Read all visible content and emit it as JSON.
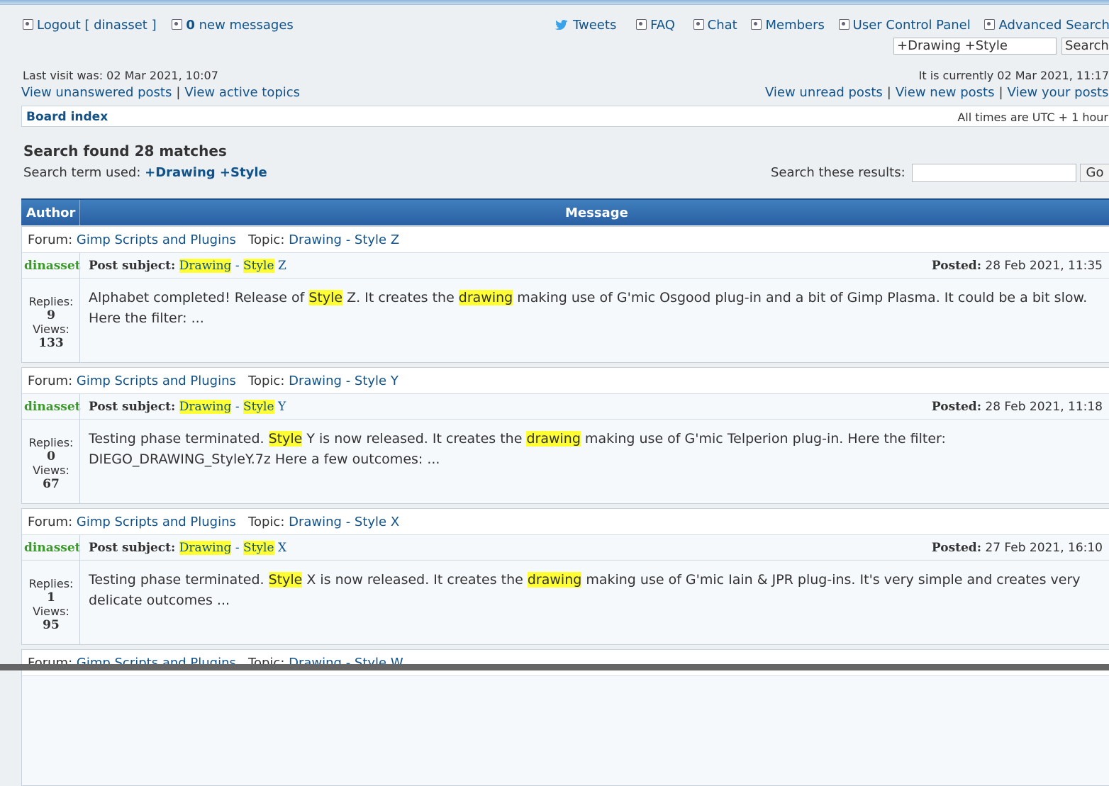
{
  "header": {
    "logout_label": "Logout [ dinasset ]",
    "messages_count": "0",
    "messages_label": "new messages",
    "nav": {
      "tweets": "Tweets",
      "faq": "FAQ",
      "chat": "Chat",
      "members": "Members",
      "ucp": "User Control Panel",
      "advanced_search": "Advanced Search"
    },
    "search_value": "+Drawing  +Style",
    "search_button": "Search",
    "last_visit": "Last visit was: 02 Mar 2021, 10:07",
    "current_time": "It is currently 02 Mar 2021, 11:17",
    "left_links": [
      "View unanswered posts",
      "View active topics"
    ],
    "right_links": [
      "View unread posts",
      "View new posts",
      "View your posts"
    ]
  },
  "breadcrumb": {
    "board_index": "Board index",
    "timezone": "All times are UTC + 1 hour"
  },
  "search": {
    "title": "Search found 28 matches",
    "term_label": "Search term used:",
    "term_value": "+Drawing +Style",
    "these_results_label": "Search these results:",
    "go_button": "Go"
  },
  "table": {
    "author_header": "Author",
    "message_header": "Message"
  },
  "labels": {
    "forum": "Forum:",
    "topic": "Topic:",
    "post_subject": "Post subject:",
    "posted": "Posted:",
    "replies": "Replies:",
    "views": "Views:",
    "sep": "-"
  },
  "results": [
    {
      "forum": "Gimp Scripts and Plugins",
      "topic": "Drawing - Style Z",
      "author": "dinasset",
      "subject_word1": "Drawing",
      "subject_word2": "Style",
      "subject_tail": "Z",
      "posted": "28 Feb 2021, 11:35",
      "replies": "9",
      "views": "133",
      "body_a": "Alphabet completed! Release of ",
      "body_hl1": "Style",
      "body_b": " Z. It creates the ",
      "body_hl2": "drawing",
      "body_c": " making use of G'mic Osgood plug-in and a bit of Gimp Plasma. It could be a bit slow. Here the filter: ..."
    },
    {
      "forum": "Gimp Scripts and Plugins",
      "topic": "Drawing - Style Y",
      "author": "dinasset",
      "subject_word1": "Drawing",
      "subject_word2": "Style",
      "subject_tail": "Y",
      "posted": "28 Feb 2021, 11:18",
      "replies": "0",
      "views": "67",
      "body_a": "Testing phase terminated. ",
      "body_hl1": "Style",
      "body_b": " Y is now released. It creates the ",
      "body_hl2": "drawing",
      "body_c": " making use of G'mic Telperion plug-in. Here the filter: DIEGO_DRAWING_StyleY.7z Here a few outcomes: ..."
    },
    {
      "forum": "Gimp Scripts and Plugins",
      "topic": "Drawing - Style X",
      "author": "dinasset",
      "subject_word1": "Drawing",
      "subject_word2": "Style",
      "subject_tail": "X",
      "posted": "27 Feb 2021, 16:10",
      "replies": "1",
      "views": "95",
      "body_a": "Testing phase terminated. ",
      "body_hl1": "Style",
      "body_b": " X is now released. It creates the ",
      "body_hl2": "drawing",
      "body_c": " making use of G'mic Iain & JPR plug-ins. It's very simple and creates very delicate outcomes ..."
    },
    {
      "forum": "Gimp Scripts and Plugins",
      "topic": "Drawing - Style W"
    }
  ]
}
